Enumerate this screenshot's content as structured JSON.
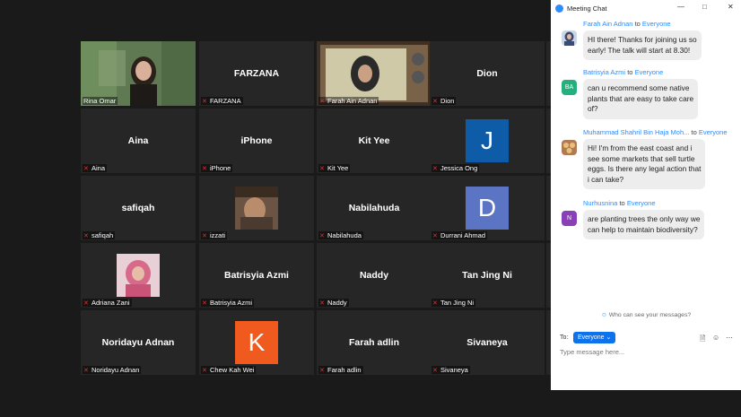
{
  "tiles": [
    {
      "name": "",
      "label": "Rina Omar"
    },
    {
      "name": "FARZANA",
      "label": "FARZANA"
    },
    {
      "name": "",
      "label": "Farah Ain Adnan"
    },
    {
      "name": "Dion",
      "label": "Dion"
    },
    {
      "name": "Aina",
      "label": "Aina"
    },
    {
      "name": "iPhone",
      "label": "iPhone"
    },
    {
      "name": "Kit Yee",
      "label": "Kit Yee"
    },
    {
      "name": "",
      "label": "Jessica Ong",
      "letter": "J"
    },
    {
      "name": "safiqah",
      "label": "safiqah"
    },
    {
      "name": "",
      "label": "izzati"
    },
    {
      "name": "Nabilahuda",
      "label": "Nabilahuda"
    },
    {
      "name": "",
      "label": "Durrani Ahmad",
      "letter": "D"
    },
    {
      "name": "",
      "label": "Adriana Zani"
    },
    {
      "name": "Batrisyia Azmi",
      "label": "Batrisyia Azmi"
    },
    {
      "name": "Naddy",
      "label": "Naddy"
    },
    {
      "name": "Tan Jing Ni",
      "label": "Tan Jing Ni"
    },
    {
      "name": "Noridayu Adnan",
      "label": "Noridayu Adnan"
    },
    {
      "name": "",
      "label": "Chew Kah Wei",
      "letter": "K"
    },
    {
      "name": "Farah adlin",
      "label": "Farah adlin"
    },
    {
      "name": "Sivaneya",
      "label": "Sivaneya"
    }
  ],
  "colors": {
    "jessica": "#0e5ba8",
    "durrani": "#5b74c4",
    "chew": "#f05a1e",
    "active_border": "#e8e35a",
    "chat_blue": "#2d8cff"
  },
  "chat": {
    "title": "Meeting Chat",
    "to_word": "to",
    "messages": [
      {
        "sender": "Farah Ain Adnan",
        "recipient": "Everyone",
        "l1": "HI there! Thanks for joining us so",
        "l2": "early! The talk will start at 8.30!",
        "l3": "",
        "l4": ""
      },
      {
        "sender": "Batrisyia Azmi",
        "recipient": "Everyone",
        "initials": "BA",
        "l1": "can u recommend some native",
        "l2": "plants that are easy to take care",
        "l3": "of?",
        "l4": ""
      },
      {
        "sender": "Muhammad Shahril Bin Haja Moh...",
        "recipient": "Everyone",
        "l1": "Hi! I'm from the east coast and i",
        "l2": "see some markets that sell turtle",
        "l3": "eggs. Is there any legal action that",
        "l4": "i can take?"
      },
      {
        "sender": "Nurhusnina",
        "recipient": "Everyone",
        "initials": "N",
        "l1": "are planting trees the only way we",
        "l2": "can help to maintain biodiversity?",
        "l3": "",
        "l4": ""
      }
    ],
    "who_can_see": "Who can see your messages?",
    "to_label": "To:",
    "recipient_dropdown": "Everyone",
    "input_placeholder": "Type message here..."
  }
}
